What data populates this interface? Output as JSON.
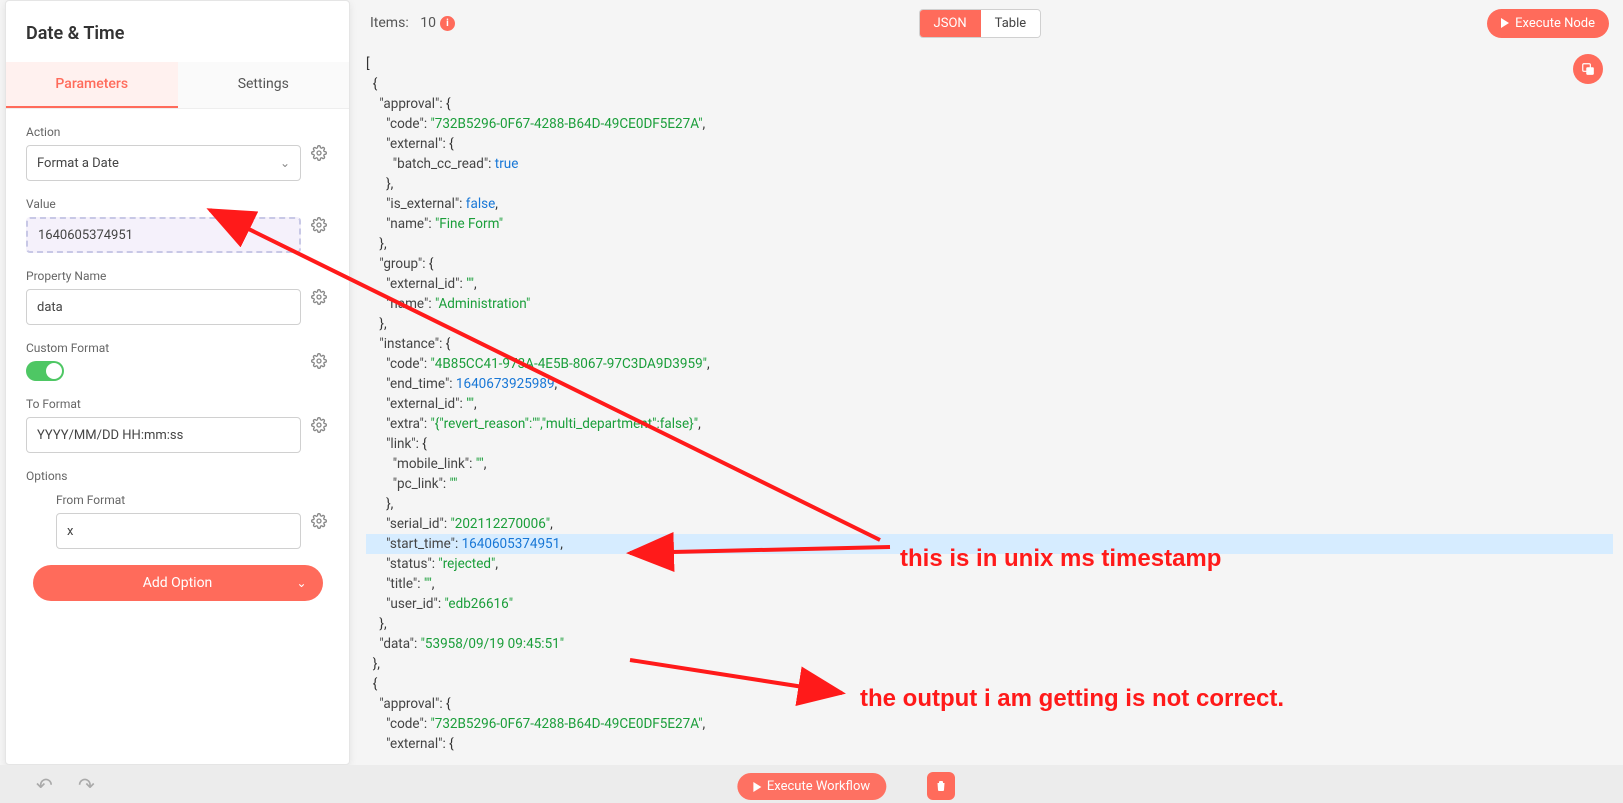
{
  "panel": {
    "title": "Date & Time",
    "tab_parameters": "Parameters",
    "tab_settings": "Settings",
    "action_label": "Action",
    "action_value": "Format a Date",
    "value_label": "Value",
    "value_value": "1640605374951",
    "property_name_label": "Property Name",
    "property_name_value": "data",
    "custom_format_label": "Custom Format",
    "to_format_label": "To Format",
    "to_format_value": "YYYY/MM/DD HH:mm:ss",
    "options_label": "Options",
    "from_format_label": "From Format",
    "from_format_value": "x",
    "add_option_label": "Add Option"
  },
  "topbar": {
    "items_label": "Items:",
    "items_count": "10",
    "json_label": "JSON",
    "table_label": "Table",
    "execute_label": "Execute Node"
  },
  "bottom": {
    "execute_workflow": "Execute Workflow"
  },
  "json_lines": [
    {
      "indent": 0,
      "text": "["
    },
    {
      "indent": 1,
      "text": "{"
    },
    {
      "indent": 2,
      "segs": [
        {
          "t": "\"approval\"",
          "c": "jk"
        },
        {
          "t": ": {"
        }
      ]
    },
    {
      "indent": 3,
      "segs": [
        {
          "t": "\"code\"",
          "c": "jk"
        },
        {
          "t": ": "
        },
        {
          "t": "\"732B5296-0F67-4288-B64D-49CE0DF5E27A\"",
          "c": "js"
        },
        {
          "t": ","
        }
      ]
    },
    {
      "indent": 3,
      "segs": [
        {
          "t": "\"external\"",
          "c": "jk"
        },
        {
          "t": ": {"
        }
      ]
    },
    {
      "indent": 4,
      "segs": [
        {
          "t": "\"batch_cc_read\"",
          "c": "jk"
        },
        {
          "t": ": "
        },
        {
          "t": "true",
          "c": "jb"
        }
      ]
    },
    {
      "indent": 3,
      "text": "},"
    },
    {
      "indent": 3,
      "segs": [
        {
          "t": "\"is_external\"",
          "c": "jk"
        },
        {
          "t": ": "
        },
        {
          "t": "false",
          "c": "jb"
        },
        {
          "t": ","
        }
      ]
    },
    {
      "indent": 3,
      "segs": [
        {
          "t": "\"name\"",
          "c": "jk"
        },
        {
          "t": ": "
        },
        {
          "t": "\"Fine Form\"",
          "c": "js"
        }
      ]
    },
    {
      "indent": 2,
      "text": "},"
    },
    {
      "indent": 2,
      "segs": [
        {
          "t": "\"group\"",
          "c": "jk"
        },
        {
          "t": ": {"
        }
      ]
    },
    {
      "indent": 3,
      "segs": [
        {
          "t": "\"external_id\"",
          "c": "jk"
        },
        {
          "t": ": "
        },
        {
          "t": "\"\"",
          "c": "js"
        },
        {
          "t": ","
        }
      ]
    },
    {
      "indent": 3,
      "segs": [
        {
          "t": "\"name\"",
          "c": "jk"
        },
        {
          "t": ": "
        },
        {
          "t": "\"Administration\"",
          "c": "js"
        }
      ]
    },
    {
      "indent": 2,
      "text": "},"
    },
    {
      "indent": 2,
      "segs": [
        {
          "t": "\"instance\"",
          "c": "jk"
        },
        {
          "t": ": {"
        }
      ]
    },
    {
      "indent": 3,
      "segs": [
        {
          "t": "\"code\"",
          "c": "jk"
        },
        {
          "t": ": "
        },
        {
          "t": "\"4B85CC41-973A-4E5B-8067-97C3DA9D3959\"",
          "c": "js"
        },
        {
          "t": ","
        }
      ]
    },
    {
      "indent": 3,
      "segs": [
        {
          "t": "\"end_time\"",
          "c": "jk"
        },
        {
          "t": ": "
        },
        {
          "t": "1640673925989",
          "c": "jn"
        },
        {
          "t": ","
        }
      ]
    },
    {
      "indent": 3,
      "segs": [
        {
          "t": "\"external_id\"",
          "c": "jk"
        },
        {
          "t": ": "
        },
        {
          "t": "\"\"",
          "c": "js"
        },
        {
          "t": ","
        }
      ]
    },
    {
      "indent": 3,
      "segs": [
        {
          "t": "\"extra\"",
          "c": "jk"
        },
        {
          "t": ": "
        },
        {
          "t": "\"{\\\"revert_reason\\\":\\\"\\\",\\\"multi_department\\\":false}\"",
          "c": "js"
        },
        {
          "t": ","
        }
      ]
    },
    {
      "indent": 3,
      "segs": [
        {
          "t": "\"link\"",
          "c": "jk"
        },
        {
          "t": ": {"
        }
      ]
    },
    {
      "indent": 4,
      "segs": [
        {
          "t": "\"mobile_link\"",
          "c": "jk"
        },
        {
          "t": ": "
        },
        {
          "t": "\"\"",
          "c": "js"
        },
        {
          "t": ","
        }
      ]
    },
    {
      "indent": 4,
      "segs": [
        {
          "t": "\"pc_link\"",
          "c": "jk"
        },
        {
          "t": ": "
        },
        {
          "t": "\"\"",
          "c": "js"
        }
      ]
    },
    {
      "indent": 3,
      "text": "},"
    },
    {
      "indent": 3,
      "segs": [
        {
          "t": "\"serial_id\"",
          "c": "jk"
        },
        {
          "t": ": "
        },
        {
          "t": "\"202112270006\"",
          "c": "js"
        },
        {
          "t": ","
        }
      ]
    },
    {
      "indent": 3,
      "hl": true,
      "segs": [
        {
          "t": "\"start_time\"",
          "c": "jk"
        },
        {
          "t": ": "
        },
        {
          "t": "1640605374951",
          "c": "jn"
        },
        {
          "t": ","
        }
      ]
    },
    {
      "indent": 3,
      "segs": [
        {
          "t": "\"status\"",
          "c": "jk"
        },
        {
          "t": ": "
        },
        {
          "t": "\"rejected\"",
          "c": "js"
        },
        {
          "t": ","
        }
      ]
    },
    {
      "indent": 3,
      "segs": [
        {
          "t": "\"title\"",
          "c": "jk"
        },
        {
          "t": ": "
        },
        {
          "t": "\"\"",
          "c": "js"
        },
        {
          "t": ","
        }
      ]
    },
    {
      "indent": 3,
      "segs": [
        {
          "t": "\"user_id\"",
          "c": "jk"
        },
        {
          "t": ": "
        },
        {
          "t": "\"edb26616\"",
          "c": "js"
        }
      ]
    },
    {
      "indent": 2,
      "text": "},"
    },
    {
      "indent": 2,
      "segs": [
        {
          "t": "\"data\"",
          "c": "jk"
        },
        {
          "t": ": "
        },
        {
          "t": "\"53958/09/19 09:45:51\"",
          "c": "js"
        }
      ]
    },
    {
      "indent": 1,
      "text": "},"
    },
    {
      "indent": 1,
      "text": "{"
    },
    {
      "indent": 2,
      "segs": [
        {
          "t": "\"approval\"",
          "c": "jk"
        },
        {
          "t": ": {"
        }
      ]
    },
    {
      "indent": 3,
      "segs": [
        {
          "t": "\"code\"",
          "c": "jk"
        },
        {
          "t": ": "
        },
        {
          "t": "\"732B5296-0F67-4288-B64D-49CE0DF5E27A\"",
          "c": "js"
        },
        {
          "t": ","
        }
      ]
    },
    {
      "indent": 3,
      "segs": [
        {
          "t": "\"external\"",
          "c": "jk"
        },
        {
          "t": ": {"
        }
      ]
    }
  ],
  "annotations": {
    "a1": "this is in unix ms timestamp",
    "a2": "the output i am getting is not correct."
  }
}
